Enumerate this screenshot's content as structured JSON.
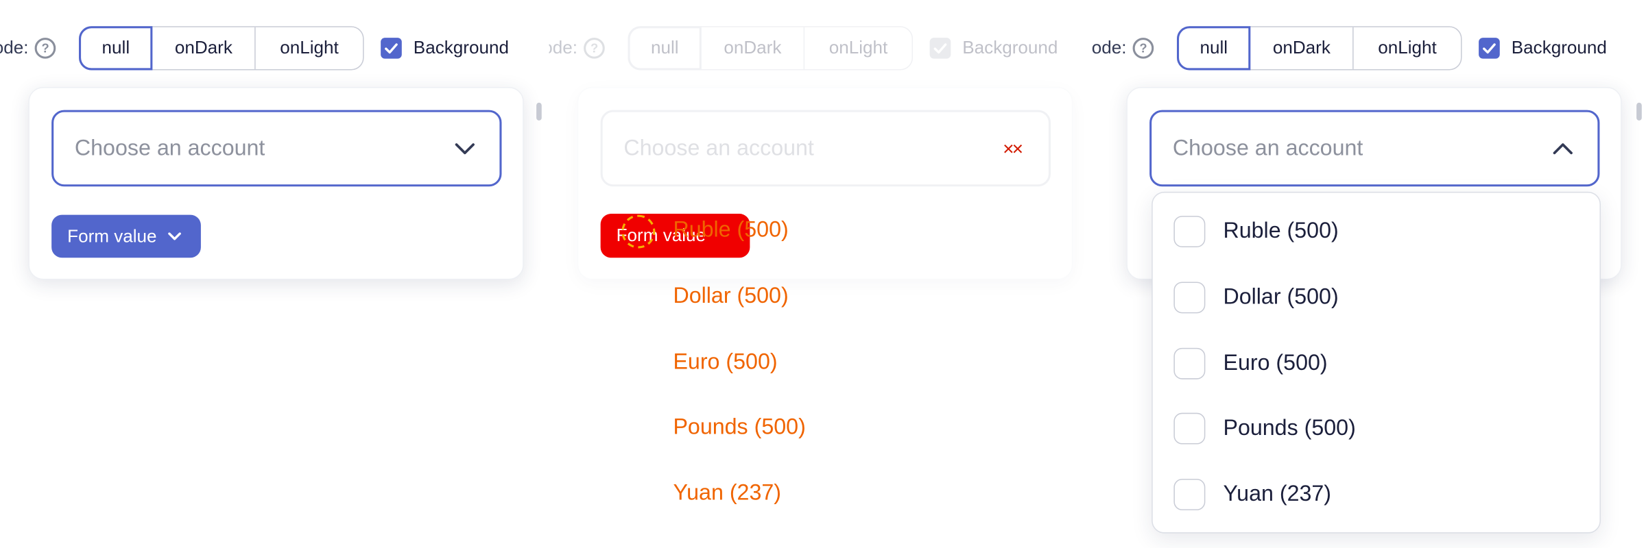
{
  "controls": {
    "mode_label": "ode:",
    "help_glyph": "?",
    "modes": [
      "null",
      "onDark",
      "onLight"
    ],
    "active_mode": "null",
    "background_label": "Background",
    "background_checked": true
  },
  "select": {
    "placeholder": "Choose an account"
  },
  "form_value": {
    "label": "Form value"
  },
  "options": [
    "Ruble (500)",
    "Dollar (500)",
    "Euro (500)",
    "Pounds (500)",
    "Yuan (237)"
  ],
  "colors": {
    "accent": "#5266cc",
    "error_red": "#f00000",
    "diff_orange": "#f06400",
    "placeholder": "#8d919d",
    "border": "#c9ccd6"
  },
  "icons": {
    "help": "question-circle-icon",
    "check": "checkmark-icon",
    "chevron_down": "chevron-down-icon",
    "chevron_up": "chevron-up-icon",
    "clear": "clear-x-icon"
  }
}
